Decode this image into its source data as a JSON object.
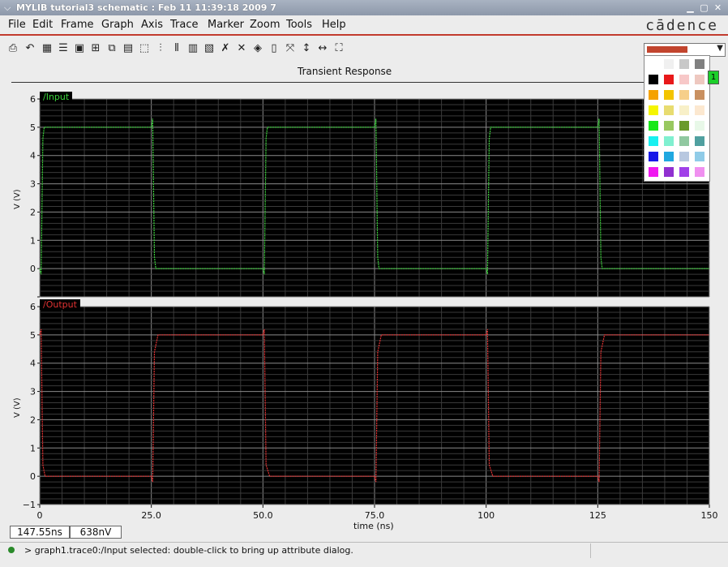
{
  "window": {
    "title": "MYLIB tutorial3 schematic : Feb 11 11:39:18 2009 7"
  },
  "menu": [
    "File",
    "Edit",
    "Frame",
    "Graph",
    "Axis",
    "Trace",
    "Marker",
    "Zoom",
    "Tools",
    "Help"
  ],
  "brand": "cādence",
  "toolbar_icons": [
    "print-icon",
    "undo-icon",
    "grid-icon",
    "strip-icon",
    "box-icon",
    "zoom-box-icon",
    "copy-icon",
    "layers-icon",
    "open-icon",
    "bars-icon",
    "columns-icon",
    "frame-icon",
    "panel-icon",
    "marker-icon",
    "cross-marker-icon",
    "diamond-icon",
    "calculator-icon",
    "fit-icon",
    "vertical-fit-icon",
    "horizontal-fit-icon",
    "zoom-fit-icon"
  ],
  "color_selector": {
    "selected_color": "#c2452e"
  },
  "palette_colors": [
    [
      "#ffffff",
      "#f0f0f0",
      "#c8c8c8",
      "#808080"
    ],
    [
      "#000000",
      "#e8191a",
      "#f7c8c8",
      "#eec8c0"
    ],
    [
      "#f5a200",
      "#f3c400",
      "#f6cf8a",
      "#c99060"
    ],
    [
      "#f5f500",
      "#e8dc70",
      "#f8f0c8",
      "#fce8d0"
    ],
    [
      "#18e818",
      "#98c860",
      "#6a9a2c",
      "#e8f8e8"
    ],
    [
      "#18f0f0",
      "#80f0d0",
      "#90c8a0",
      "#50a0a0"
    ],
    [
      "#1818e8",
      "#20a8e0",
      "#b8c8e0",
      "#90cce8"
    ],
    [
      "#f018f0",
      "#9030d0",
      "#a040e8",
      "#f090f0"
    ]
  ],
  "badge": "1",
  "plot_title": "Transient Response",
  "cursor": {
    "x_readout": "147.55ns",
    "y_readout": "638nV"
  },
  "status_message": "> graph1.trace0:/Input selected: double-click to bring up attribute dialog.",
  "colors": {
    "input_trace": "#3cd23c",
    "output_trace": "#e23232",
    "plot_bg": "#000000"
  },
  "chart_data": [
    {
      "type": "line",
      "legend": "/Input",
      "ylabel": "V (V)",
      "xlabel": "",
      "xlim": [
        0,
        150
      ],
      "ylim": [
        -1,
        6
      ],
      "yticks": [
        -1,
        0,
        1,
        2,
        3,
        4,
        5,
        6
      ],
      "ytick_labels": [
        "",
        "0",
        "1",
        "2",
        "3",
        "4",
        "5",
        "6"
      ],
      "xticks": [],
      "grid": true,
      "series": [
        {
          "name": "/Input",
          "color": "#3cd23c",
          "x": [
            0,
            0.3,
            0.7,
            1,
            25,
            25.3,
            25.7,
            26,
            50,
            50.3,
            50.7,
            51,
            75,
            75.3,
            75.7,
            76,
            100,
            100.3,
            100.7,
            101,
            125,
            125.3,
            125.7,
            126,
            150
          ],
          "y": [
            0,
            -0.2,
            4.6,
            5,
            5,
            5.3,
            0.4,
            0,
            0,
            -0.2,
            4.6,
            5,
            5,
            5.3,
            0.4,
            0,
            0,
            -0.2,
            4.6,
            5,
            5,
            5.3,
            0.4,
            0,
            0
          ]
        }
      ]
    },
    {
      "type": "line",
      "legend": "/Output",
      "ylabel": "V (V)",
      "xlabel": "time (ns)",
      "xlim": [
        0,
        150
      ],
      "ylim": [
        -1,
        6
      ],
      "yticks": [
        -1,
        0,
        1,
        2,
        3,
        4,
        5,
        6
      ],
      "ytick_labels": [
        "−1",
        "0",
        "1",
        "2",
        "3",
        "4",
        "5",
        "6"
      ],
      "xticks": [
        0,
        25,
        50,
        75,
        100,
        125,
        150
      ],
      "xtick_labels": [
        "0",
        "25.0",
        "50.0",
        "75.0",
        "100",
        "125",
        "150"
      ],
      "grid": true,
      "series": [
        {
          "name": "/Output",
          "color": "#e23232",
          "x": [
            0,
            0.3,
            0.7,
            1.2,
            25,
            25.3,
            25.7,
            26.5,
            50,
            50.3,
            50.7,
            51.5,
            75,
            75.3,
            75.7,
            76.5,
            100,
            100.3,
            100.7,
            101.5,
            125,
            125.3,
            125.7,
            126.5,
            150
          ],
          "y": [
            5,
            5.2,
            0.4,
            0,
            0,
            -0.2,
            4.4,
            5,
            5,
            5.2,
            0.4,
            0,
            0,
            -0.2,
            4.4,
            5,
            5,
            5.2,
            0.4,
            0,
            0,
            -0.2,
            4.4,
            5,
            5
          ]
        }
      ]
    }
  ]
}
